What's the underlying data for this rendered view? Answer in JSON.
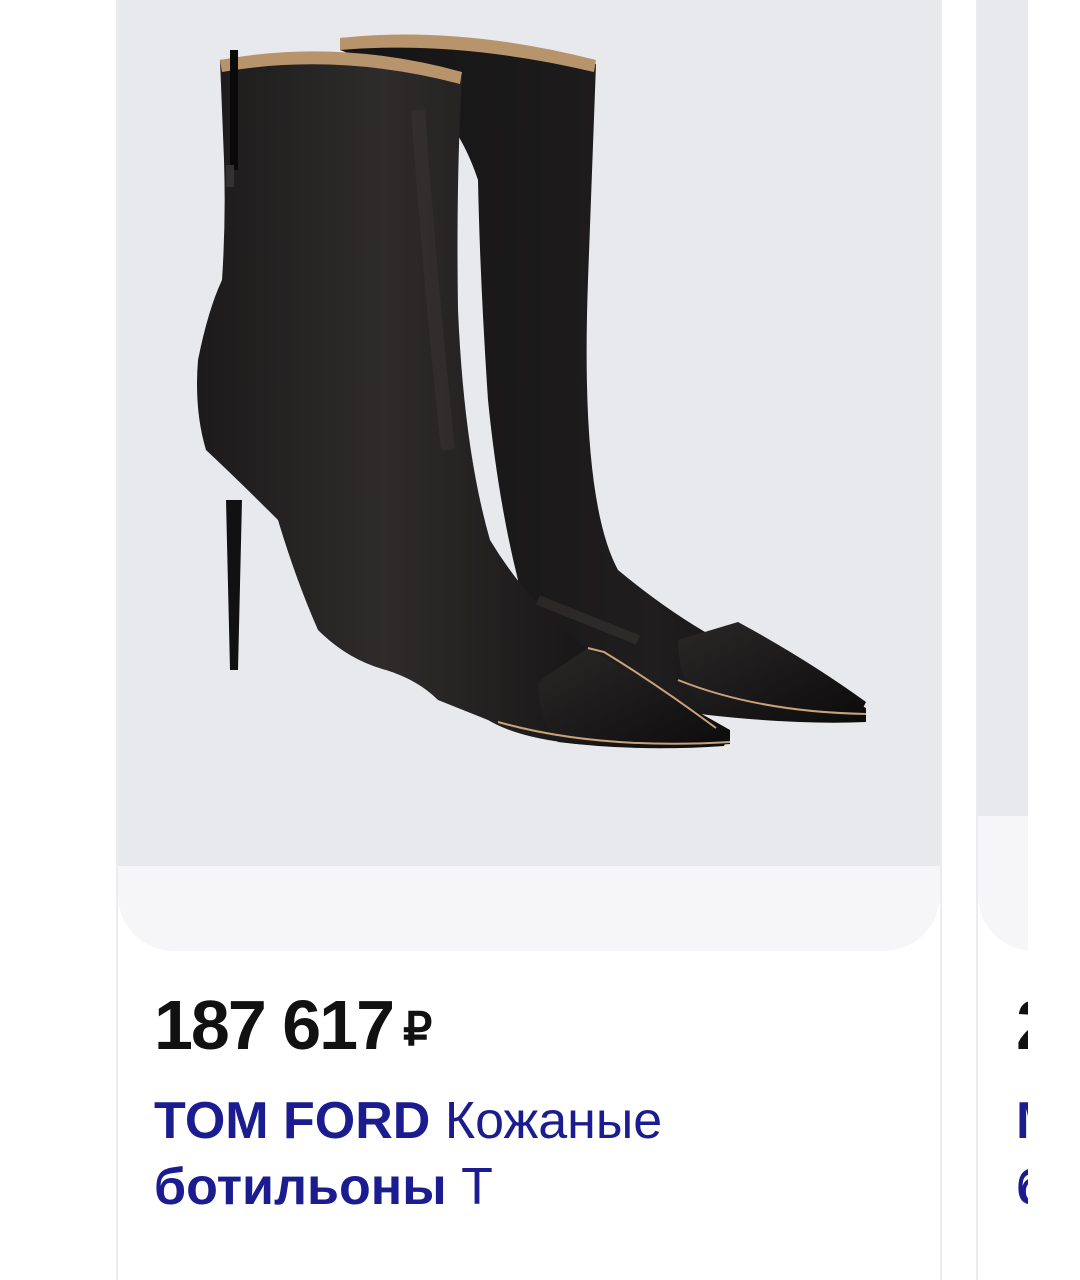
{
  "product": {
    "price": "187 617",
    "currency": "₽",
    "brand": "TOM FORD",
    "name_line1": "Кожаные",
    "name_line2_bold": "ботильоны",
    "name_line2_rest": "T",
    "image_icon": "boots-photo"
  },
  "next_product": {
    "price_fragment": "2",
    "title_fragment_line1": "M",
    "title_fragment_line2": "б"
  }
}
